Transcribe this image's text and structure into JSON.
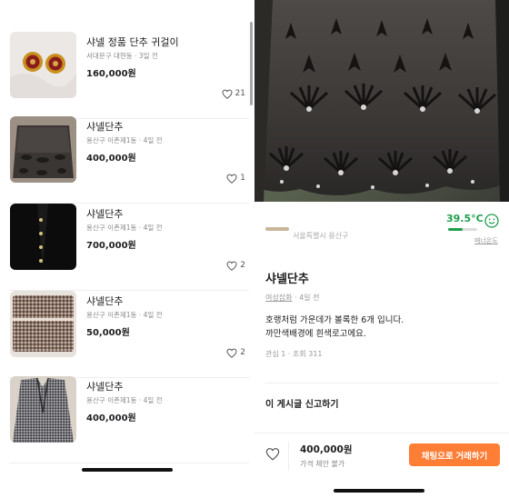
{
  "listings": [
    {
      "title": "샤넬 정품 단추 귀걸이",
      "meta": "서대문구 대현동 · 3일 전",
      "price": "160,000원",
      "likes": "21"
    },
    {
      "title": "샤넬단추",
      "meta": "용산구 이촌제1동 · 4일 전",
      "price": "400,000원",
      "likes": "1"
    },
    {
      "title": "샤넬단추",
      "meta": "용산구 이촌제1동 · 4일 전",
      "price": "700,000원",
      "likes": "2"
    },
    {
      "title": "샤넬단추",
      "meta": "용산구 이촌제1동 · 4일 전",
      "price": "50,000원",
      "likes": "2"
    },
    {
      "title": "샤넬단추",
      "meta": "용산구 이촌제1동 · 4일 전",
      "price": "400,000원",
      "likes": ""
    }
  ],
  "detail": {
    "seller_partial": "서울특별시 용산구",
    "manner_temp": "39.5°C",
    "manner_temp_level": 0.5,
    "manner_label": "매너온도",
    "title": "샤넬단추",
    "category": "여성잡화",
    "time": "· 4일 전",
    "body_line1": "호랭처럼 가운데가 볼록한 6개 입니다.",
    "body_line2": "까만색배경에 흰색로고에요.",
    "stats": "관심 1 · 조회 311",
    "report": "이 게시글 신고하기",
    "price": "400,000원",
    "negotiation": "가격 제안 불가",
    "chat_button": "채팅으로 거래하기"
  },
  "colors": {
    "accent": "#ff7e36",
    "temp_green": "#1f9e4c"
  }
}
